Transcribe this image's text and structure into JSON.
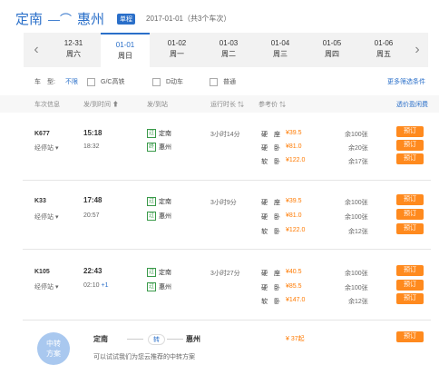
{
  "header": {
    "from": "定南",
    "arrow": "—⌒",
    "to": "惠州",
    "badge": "单程",
    "date_info": "2017-01-01（共3个车次）"
  },
  "dates": [
    {
      "date": "12-31",
      "weekday": "周六"
    },
    {
      "date": "01-01",
      "weekday": "周日"
    },
    {
      "date": "01-02",
      "weekday": "周一"
    },
    {
      "date": "01-03",
      "weekday": "周二"
    },
    {
      "date": "01-04",
      "weekday": "周三"
    },
    {
      "date": "01-05",
      "weekday": "周四"
    },
    {
      "date": "01-06",
      "weekday": "周五"
    }
  ],
  "filters": {
    "label": "车　型:",
    "all": "不限",
    "options": [
      "G/C高铁",
      "D动车",
      "普通"
    ],
    "more": "更多筛选条件"
  },
  "columns": {
    "train": "车次信息",
    "depart": "发/到时间 ⬆",
    "station": "发/到站",
    "duration": "运行时长 ⇅",
    "price": "参考价 ⇅",
    "fold": "透价盈闲费"
  },
  "trains": [
    {
      "code": "K677",
      "via": "经停站 ▾",
      "dep": "15:18",
      "arr": "18:32",
      "arr_extra": "",
      "from_icon": "过",
      "from": "定南",
      "to_icon": "终",
      "to": "惠州",
      "duration": "3小时14分",
      "seats": [
        {
          "type": "硬　座",
          "price": "¥39.5",
          "left": "余100张",
          "book": "预订"
        },
        {
          "type": "硬　卧",
          "price": "¥81.0",
          "left": "余20张",
          "book": "预订"
        },
        {
          "type": "软　卧",
          "price": "¥122.0",
          "left": "余17张",
          "book": "预订"
        }
      ]
    },
    {
      "code": "K33",
      "via": "经停站 ▾",
      "dep": "17:48",
      "arr": "20:57",
      "arr_extra": "",
      "from_icon": "过",
      "from": "定南",
      "to_icon": "过",
      "to": "惠州",
      "duration": "3小时9分",
      "seats": [
        {
          "type": "硬　座",
          "price": "¥39.5",
          "left": "余100张",
          "book": "预订"
        },
        {
          "type": "硬　卧",
          "price": "¥81.0",
          "left": "余100张",
          "book": "预订"
        },
        {
          "type": "软　卧",
          "price": "¥122.0",
          "left": "余12张",
          "book": "预订"
        }
      ]
    },
    {
      "code": "K105",
      "via": "经停站 ▾",
      "dep": "22:43",
      "arr": "02:10",
      "arr_extra": "+1",
      "from_icon": "过",
      "from": "定南",
      "to_icon": "过",
      "to": "惠州",
      "duration": "3小时27分",
      "seats": [
        {
          "type": "硬　座",
          "price": "¥40.5",
          "left": "余100张",
          "book": "预订"
        },
        {
          "type": "硬　卧",
          "price": "¥85.5",
          "left": "余100张",
          "book": "预订"
        },
        {
          "type": "软　卧",
          "price": "¥147.0",
          "left": "余12张",
          "book": "预订"
        }
      ]
    }
  ],
  "transfer": {
    "badge_line1": "中转",
    "badge_line2": "方案",
    "from": "定南",
    "via": "转",
    "to": "惠州",
    "price": "¥ 37起",
    "note": "可以试试我们为您云推荐的中转方案",
    "book": "预订"
  },
  "colors": {
    "accent": "#2a6fc9",
    "button": "#ff8a1e",
    "price": "#ff7a00"
  }
}
